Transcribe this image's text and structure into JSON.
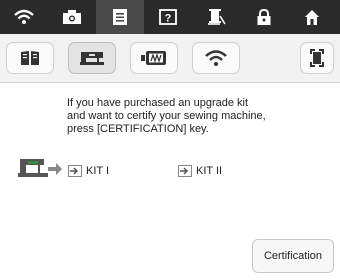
{
  "top_tabs": [
    {
      "icon": "wifi-icon"
    },
    {
      "icon": "camera-icon"
    },
    {
      "icon": "document-icon",
      "active": true
    },
    {
      "icon": "help-icon"
    },
    {
      "icon": "thread-spool-icon"
    },
    {
      "icon": "lock-icon"
    },
    {
      "icon": "home-icon"
    }
  ],
  "sub_tabs": [
    {
      "icon": "book-icon"
    },
    {
      "icon": "sewing-machine-icon",
      "active": true
    },
    {
      "icon": "embroidery-frame-icon"
    },
    {
      "icon": "wifi-icon"
    },
    {
      "icon": "expand-icon"
    }
  ],
  "message": {
    "line1": "If you have purchased an upgrade kit",
    "line2": "and want to certify your sewing machine,",
    "line3": "press [CERTIFICATION] key."
  },
  "kits": {
    "kit1_label": "KIT I",
    "kit2_label": "KIT II"
  },
  "certification_button": {
    "label": "Certification"
  },
  "colors": {
    "topbar": "#2b2b2b",
    "subbar": "#f2f2f2",
    "accent_green": "#3a8c3a"
  }
}
